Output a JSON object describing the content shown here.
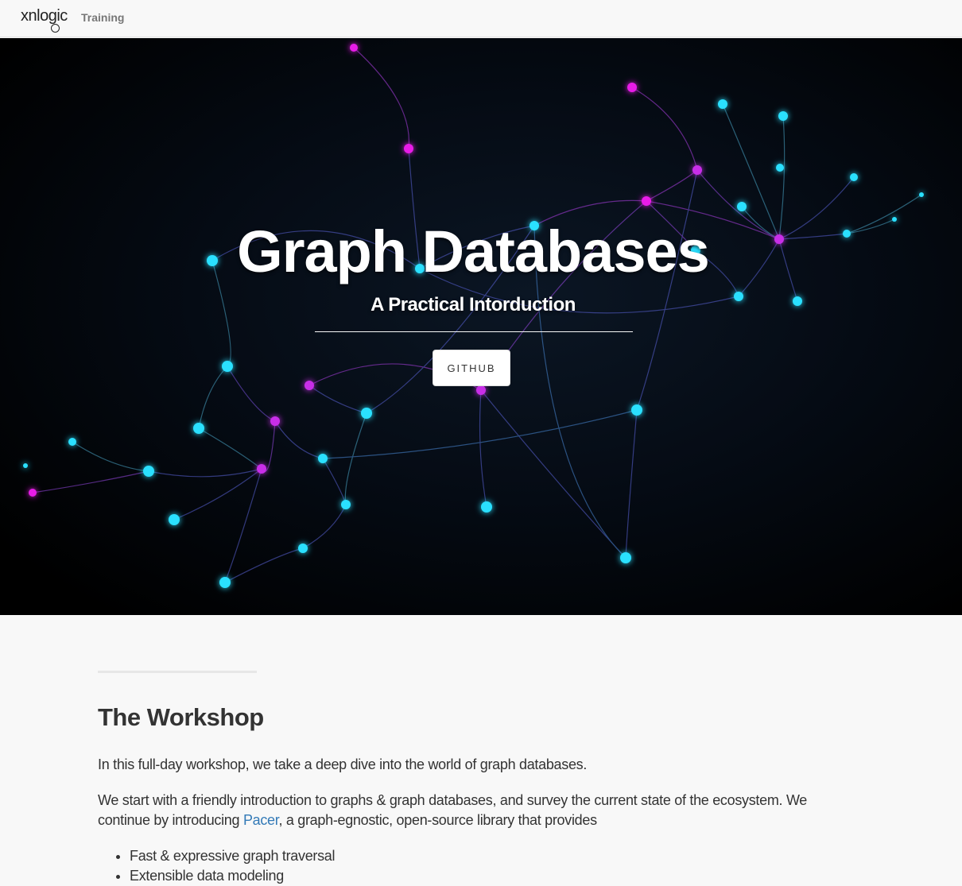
{
  "navbar": {
    "logo_text": "xnlogic",
    "section_label": "Training"
  },
  "hero": {
    "title": "Graph Databases",
    "subtitle": "A Practical Intorduction",
    "button_label": "GITHUB"
  },
  "workshop": {
    "heading": "The Workshop",
    "paragraph1": "In this full-day workshop, we take a deep dive into the world of graph databases.",
    "paragraph2_before": "We start with a friendly introduction to graphs & graph databases, and survey the current state of the ecosystem. We continue by introducing ",
    "paragraph2_link": "Pacer",
    "paragraph2_after": ", a graph-egnostic, open-source library that provides",
    "features": [
      "Fast & expressive graph traversal",
      "Extensible data modeling"
    ]
  },
  "colors": {
    "cyan_node": "#29e0ff",
    "magenta_node": "#e81ee8",
    "link": "#337ab7"
  }
}
